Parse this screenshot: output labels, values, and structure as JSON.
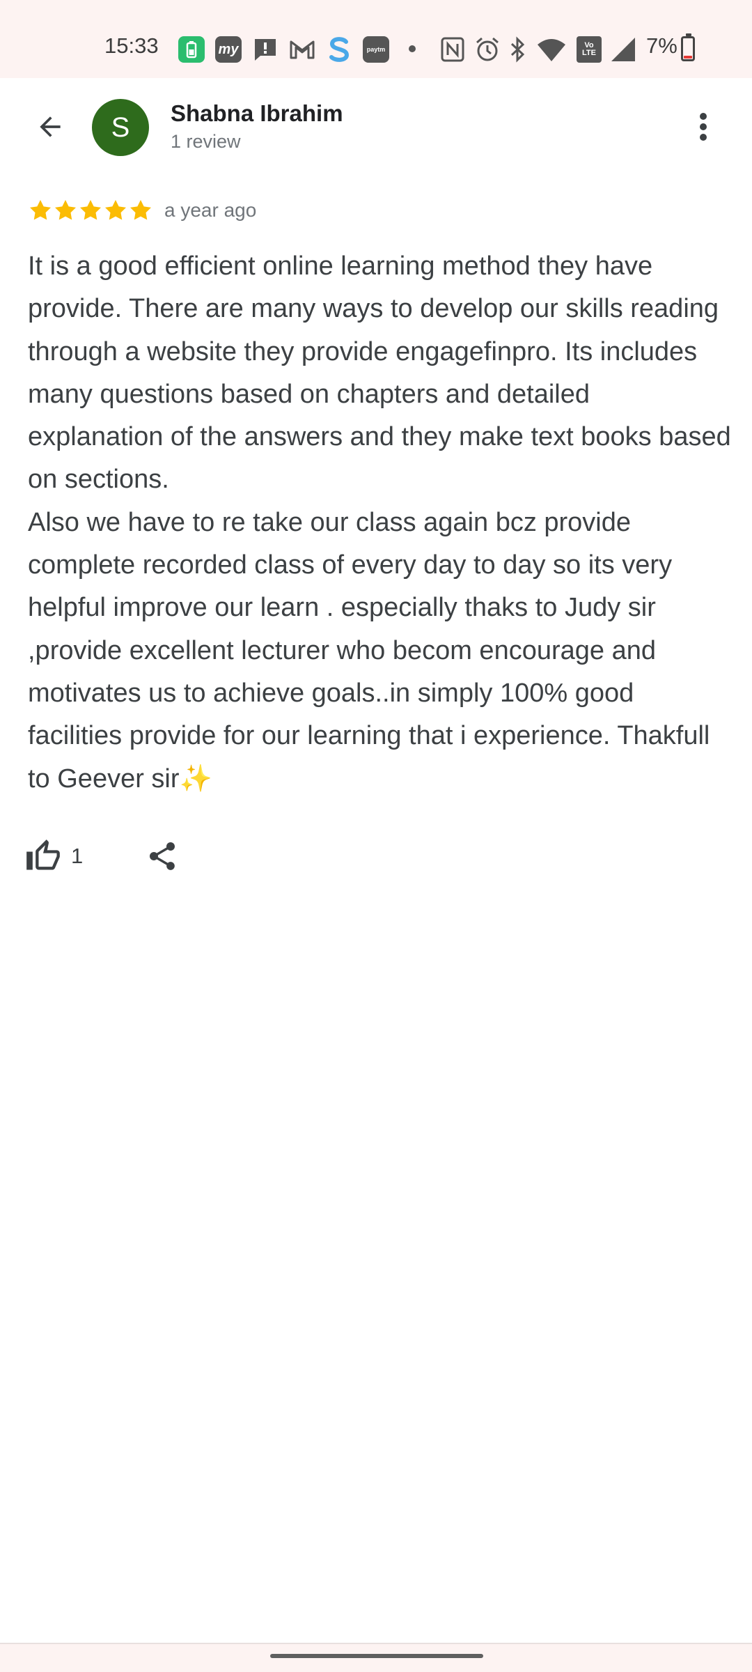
{
  "status_bar": {
    "time": "15:33",
    "battery_text": "7%",
    "icons": [
      "battery-saver-app-icon",
      "myjio-app-icon",
      "messages-icon",
      "gmail-icon",
      "s-app-icon",
      "paytm-icon",
      "dot-icon",
      "nfc-icon",
      "alarm-icon",
      "bluetooth-icon",
      "wifi-icon",
      "volte-icon",
      "signal-icon",
      "battery-icon"
    ],
    "app_icon_labels": {
      "myjio": "my",
      "paytm": "paytm",
      "volte": "Vo LTE"
    }
  },
  "header": {
    "back_icon": "arrow-back-icon",
    "avatar_letter": "S",
    "avatar_color": "#2e6b1c",
    "name": "Shabna Ibrahim",
    "subtitle": "1 review",
    "more_icon": "more-vert-icon"
  },
  "review": {
    "rating": 5,
    "max_rating": 5,
    "star_color": "#fbbc04",
    "time": "a year ago",
    "text": "It is a good efficient online learning method they have provide. There are many ways to develop our skills reading through a website they provide engagefinpro. Its includes many questions based on chapters and detailed explanation of the answers and they make text books based on sections.\nAlso we have to re take our class again bcz provide complete recorded class of every day to day so its very helpful improve our learn . especially thaks to Judy sir ,provide excellent lecturer who becom encourage and motivates us to achieve goals..in simply 100% good facilities provide for our learning that i experience. Thakfull to Geever sir✨"
  },
  "actions": {
    "like_icon": "thumb-up-outline-icon",
    "like_count": "1",
    "share_icon": "share-icon"
  }
}
